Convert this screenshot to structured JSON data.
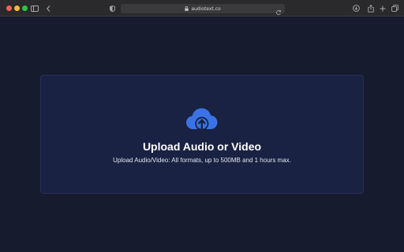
{
  "browser": {
    "url": "audiotext.co",
    "icons": [
      "sidebar-icon",
      "back-arrow-icon",
      "shield-icon",
      "lock-icon",
      "reload-icon",
      "download-icon",
      "share-icon",
      "plus-icon",
      "tabs-icon"
    ]
  },
  "upload": {
    "icon": "cloud-upload-icon",
    "title": "Upload Audio or Video",
    "description": "Upload Audio/Video: All formats, up to 500MB and 1 hours max."
  },
  "colors": {
    "page_background": "#161b2e",
    "card_background": "#192242",
    "accent": "#3b73e6"
  }
}
